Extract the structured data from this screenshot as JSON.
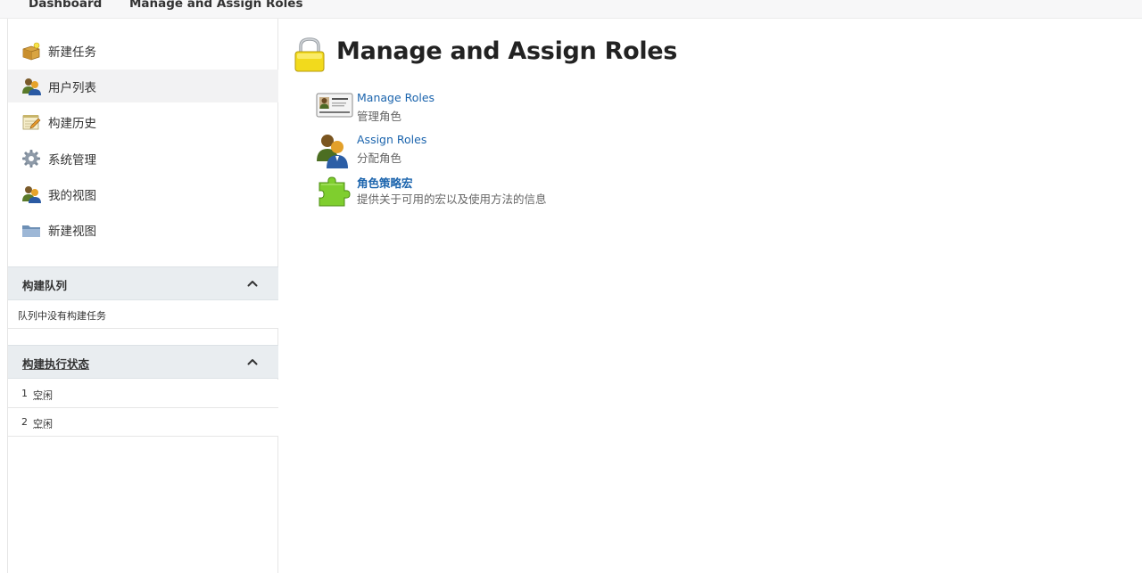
{
  "breadcrumb": {
    "items": [
      "Dashboard",
      "Manage and Assign Roles"
    ]
  },
  "sidebar": {
    "tasks": [
      {
        "label": "新建任务",
        "icon": "new-package-icon"
      },
      {
        "label": "用户列表",
        "icon": "users-icon"
      },
      {
        "label": "构建历史",
        "icon": "notepad-icon"
      },
      {
        "label": "系统管理",
        "icon": "gear-icon"
      },
      {
        "label": "我的视图",
        "icon": "users-icon"
      },
      {
        "label": "新建视图",
        "icon": "folder-icon"
      }
    ],
    "build_queue": {
      "title": "构建队列",
      "empty_text": "队列中没有构建任务"
    },
    "executors": {
      "title": "构建执行状态",
      "rows": [
        {
          "number": "1",
          "status": "空闲"
        },
        {
          "number": "2",
          "status": "空闲"
        }
      ]
    }
  },
  "main": {
    "title": "Manage and Assign Roles",
    "title_icon": "lock-icon",
    "items": [
      {
        "label": "Manage Roles",
        "description": "管理角色",
        "icon": "id-card-icon"
      },
      {
        "label": "Assign Roles",
        "description": "分配角色",
        "icon": "users-icon"
      },
      {
        "label": "角色策略宏",
        "description": "提供关于可用的宏以及使用方法的信息",
        "icon": "puzzle-icon"
      }
    ]
  },
  "colors": {
    "link": "#1b64ad",
    "pane_header": "#e9edf0",
    "active_task": "#f2f2f3"
  }
}
